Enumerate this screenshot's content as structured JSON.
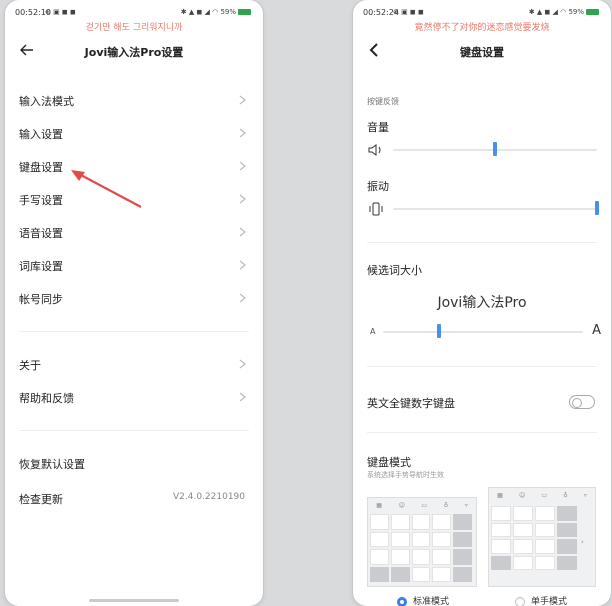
{
  "left_screen": {
    "status": {
      "time": "00:52:10",
      "icons": "⊛ ▣ ◼ ◼",
      "right": "✱ ▲ ◼ ◢ ◠ 59%"
    },
    "overlay_text": "걷기만 해도 그리워지니까",
    "title": "Jovi输入法Pro设置",
    "items": [
      {
        "label": "输入法模式"
      },
      {
        "label": "输入设置"
      },
      {
        "label": "键盘设置"
      },
      {
        "label": "手写设置"
      },
      {
        "label": "语音设置"
      },
      {
        "label": "词库设置"
      },
      {
        "label": "帐号同步"
      }
    ],
    "items2": [
      {
        "label": "关于"
      },
      {
        "label": "帮助和反馈"
      }
    ],
    "reset_label": "恢复默认设置",
    "update_label": "检查更新",
    "version": "V2.4.0.2210190",
    "accent": "#e04a4a"
  },
  "right_screen": {
    "status": {
      "time": "00:52:24",
      "icons": "⊛ ▣ ◼ ◼",
      "right": "✱ ▲ ◼ ◢ ◠ 59%"
    },
    "overlay_text": "竟然停不了对你的迷恋感觉要发烧",
    "title": "键盘设置",
    "feedback_caption": "按键反馈",
    "volume_label": "音量",
    "volume_level": 0.5,
    "vibration_label": "振动",
    "vibration_level": 1.0,
    "candidate_size_label": "候选词大小",
    "candidate_preview": "Jovi输入法Pro",
    "candidate_size_level": 0.28,
    "size_min": "A",
    "size_max": "A",
    "english_numeric_label": "英文全键数字键盘",
    "english_numeric_on": false,
    "keyboard_mode_label": "键盘模式",
    "keyboard_mode_caption": "系统选择手势导航时生效",
    "mode_standard": "标准模式",
    "mode_onehand": "单手模式",
    "selected_mode": "standard",
    "accent": "#4a8fe8"
  }
}
